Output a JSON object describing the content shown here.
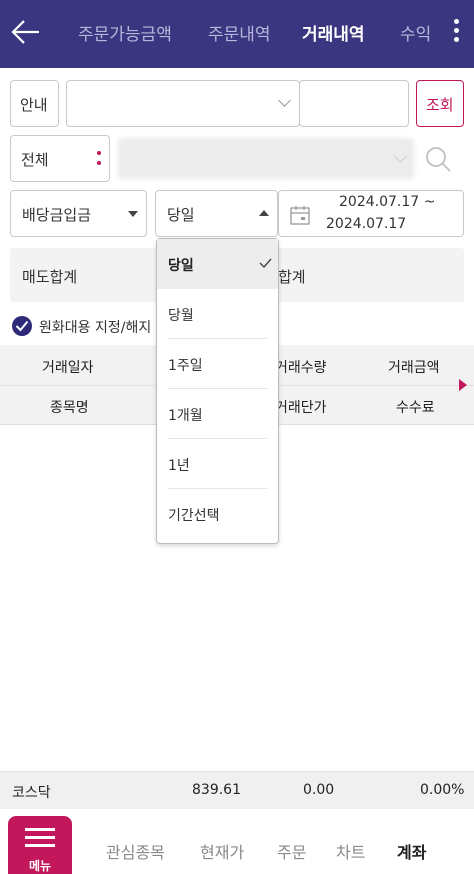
{
  "header": {
    "tabs": [
      {
        "label": "주문가능금액",
        "active": false
      },
      {
        "label": "주문내역",
        "active": false
      },
      {
        "label": "거래내역",
        "active": true
      },
      {
        "label": "수익",
        "active": false
      }
    ],
    "background": "#3b3680"
  },
  "filters": {
    "guide_label": "안내",
    "query_button": "조회",
    "all_label": "전체",
    "type_select": "배당금입금",
    "period_select": "당일",
    "date_start": "2024.07.17 ~",
    "date_end": "2024.07.17"
  },
  "summary": {
    "sell_total_label": "매도합계",
    "buy_total_label": "합계"
  },
  "krw_checkbox_label": "원화대용 지정/해지",
  "table": {
    "row1": [
      "거래일자",
      "거래수량",
      "거래금액"
    ],
    "row2": [
      "종목명",
      "거래단가",
      "수수료"
    ]
  },
  "dropdown": {
    "options": [
      "당일",
      "당월",
      "1주일",
      "1개월",
      "1년",
      "기간선택"
    ],
    "selected": "당일"
  },
  "ticker": {
    "name": "코스닥",
    "price": "839.61",
    "change": "0.00",
    "rate": "0.00%"
  },
  "bottom_nav": {
    "menu_label": "메뉴",
    "items": [
      {
        "label": "관심종목",
        "active": false
      },
      {
        "label": "현재가",
        "active": false
      },
      {
        "label": "주문",
        "active": false
      },
      {
        "label": "차트",
        "active": false
      },
      {
        "label": "계좌",
        "active": true
      }
    ]
  },
  "colors": {
    "accent": "#c2185b",
    "header": "#3b3680"
  }
}
